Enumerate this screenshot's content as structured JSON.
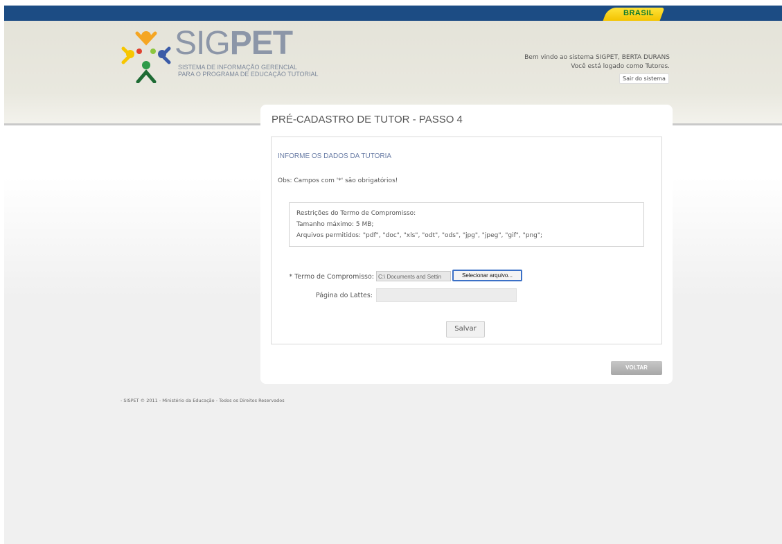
{
  "header": {
    "brasil_label": "BRASIL",
    "logo_title_light": "SIG",
    "logo_title_bold": "PET",
    "logo_subtitle_line1": "SISTEMA DE INFORMAÇÃO GERENCIAL",
    "logo_subtitle_line2": "PARA O PROGRAMA DE EDUCAÇÃO TUTORIAL",
    "welcome_line1": "Bem vindo ao sistema SIGPET, BERTA DURANS",
    "welcome_line2": "Você está logado como Tutores.",
    "logout_label": "Sair do sistema"
  },
  "panel": {
    "title": "PRÉ-CADASTRO DE TUTOR - PASSO 4",
    "section_title": "INFORME OS DADOS DA TUTORIA",
    "obs": "Obs: Campos com '*' são obrigatórios!",
    "restrictions": {
      "line1": "Restrições do Termo de Compromisso:",
      "line2": "Tamanho máximo: 5 MB;",
      "line3": "Arquivos permitidos: \"pdf\", \"doc\", \"xls\", \"odt\", \"ods\", \"jpg\", \"jpeg\", \"gif\", \"png\";"
    },
    "form": {
      "termo_label": "* Termo de Compromisso:",
      "file_path": "C:\\ Documents and Settin",
      "file_button": "Selecionar arquivo...",
      "lattes_label": "Página do Lattes:",
      "lattes_value": "",
      "save_label": "Salvar"
    },
    "back_label": "VOLTAR"
  },
  "footer": {
    "text": "- SISPET © 2011 - Ministério da Educação - Todos os Direitos Reservados"
  },
  "colors": {
    "topbar": "#1c4c84",
    "brasil_tab": "#f3c300",
    "accent_title": "#6a7da6"
  }
}
